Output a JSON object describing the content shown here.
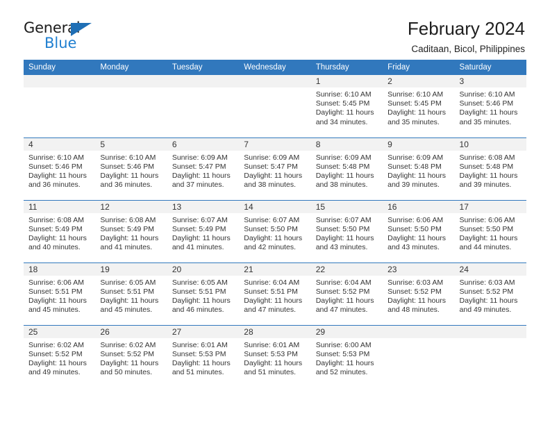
{
  "brand": {
    "name_top": "General",
    "name_bottom": "Blue",
    "triangle_color": "#1f6fb5",
    "blue_color": "#1f7fd0"
  },
  "header": {
    "title": "February 2024",
    "subtitle": "Caditaan, Bicol, Philippines",
    "accent_color": "#3178bd"
  },
  "weekday_headers": [
    "Sunday",
    "Monday",
    "Tuesday",
    "Wednesday",
    "Thursday",
    "Friday",
    "Saturday"
  ],
  "labels": {
    "sunrise_prefix": "Sunrise:",
    "sunset_prefix": "Sunset:",
    "daylight_prefix": "Daylight:"
  },
  "weeks": [
    [
      {
        "day": "",
        "blank": true,
        "sunrise": "",
        "sunset": "",
        "daylight_line1": "",
        "daylight_line2": ""
      },
      {
        "day": "",
        "blank": true,
        "sunrise": "",
        "sunset": "",
        "daylight_line1": "",
        "daylight_line2": ""
      },
      {
        "day": "",
        "blank": true,
        "sunrise": "",
        "sunset": "",
        "daylight_line1": "",
        "daylight_line2": ""
      },
      {
        "day": "",
        "blank": true,
        "sunrise": "",
        "sunset": "",
        "daylight_line1": "",
        "daylight_line2": ""
      },
      {
        "day": "1",
        "blank": false,
        "sunrise": "Sunrise: 6:10 AM",
        "sunset": "Sunset: 5:45 PM",
        "daylight_line1": "Daylight: 11 hours",
        "daylight_line2": "and 34 minutes."
      },
      {
        "day": "2",
        "blank": false,
        "sunrise": "Sunrise: 6:10 AM",
        "sunset": "Sunset: 5:45 PM",
        "daylight_line1": "Daylight: 11 hours",
        "daylight_line2": "and 35 minutes."
      },
      {
        "day": "3",
        "blank": false,
        "sunrise": "Sunrise: 6:10 AM",
        "sunset": "Sunset: 5:46 PM",
        "daylight_line1": "Daylight: 11 hours",
        "daylight_line2": "and 35 minutes."
      }
    ],
    [
      {
        "day": "4",
        "blank": false,
        "sunrise": "Sunrise: 6:10 AM",
        "sunset": "Sunset: 5:46 PM",
        "daylight_line1": "Daylight: 11 hours",
        "daylight_line2": "and 36 minutes."
      },
      {
        "day": "5",
        "blank": false,
        "sunrise": "Sunrise: 6:10 AM",
        "sunset": "Sunset: 5:46 PM",
        "daylight_line1": "Daylight: 11 hours",
        "daylight_line2": "and 36 minutes."
      },
      {
        "day": "6",
        "blank": false,
        "sunrise": "Sunrise: 6:09 AM",
        "sunset": "Sunset: 5:47 PM",
        "daylight_line1": "Daylight: 11 hours",
        "daylight_line2": "and 37 minutes."
      },
      {
        "day": "7",
        "blank": false,
        "sunrise": "Sunrise: 6:09 AM",
        "sunset": "Sunset: 5:47 PM",
        "daylight_line1": "Daylight: 11 hours",
        "daylight_line2": "and 38 minutes."
      },
      {
        "day": "8",
        "blank": false,
        "sunrise": "Sunrise: 6:09 AM",
        "sunset": "Sunset: 5:48 PM",
        "daylight_line1": "Daylight: 11 hours",
        "daylight_line2": "and 38 minutes."
      },
      {
        "day": "9",
        "blank": false,
        "sunrise": "Sunrise: 6:09 AM",
        "sunset": "Sunset: 5:48 PM",
        "daylight_line1": "Daylight: 11 hours",
        "daylight_line2": "and 39 minutes."
      },
      {
        "day": "10",
        "blank": false,
        "sunrise": "Sunrise: 6:08 AM",
        "sunset": "Sunset: 5:48 PM",
        "daylight_line1": "Daylight: 11 hours",
        "daylight_line2": "and 39 minutes."
      }
    ],
    [
      {
        "day": "11",
        "blank": false,
        "sunrise": "Sunrise: 6:08 AM",
        "sunset": "Sunset: 5:49 PM",
        "daylight_line1": "Daylight: 11 hours",
        "daylight_line2": "and 40 minutes."
      },
      {
        "day": "12",
        "blank": false,
        "sunrise": "Sunrise: 6:08 AM",
        "sunset": "Sunset: 5:49 PM",
        "daylight_line1": "Daylight: 11 hours",
        "daylight_line2": "and 41 minutes."
      },
      {
        "day": "13",
        "blank": false,
        "sunrise": "Sunrise: 6:07 AM",
        "sunset": "Sunset: 5:49 PM",
        "daylight_line1": "Daylight: 11 hours",
        "daylight_line2": "and 41 minutes."
      },
      {
        "day": "14",
        "blank": false,
        "sunrise": "Sunrise: 6:07 AM",
        "sunset": "Sunset: 5:50 PM",
        "daylight_line1": "Daylight: 11 hours",
        "daylight_line2": "and 42 minutes."
      },
      {
        "day": "15",
        "blank": false,
        "sunrise": "Sunrise: 6:07 AM",
        "sunset": "Sunset: 5:50 PM",
        "daylight_line1": "Daylight: 11 hours",
        "daylight_line2": "and 43 minutes."
      },
      {
        "day": "16",
        "blank": false,
        "sunrise": "Sunrise: 6:06 AM",
        "sunset": "Sunset: 5:50 PM",
        "daylight_line1": "Daylight: 11 hours",
        "daylight_line2": "and 43 minutes."
      },
      {
        "day": "17",
        "blank": false,
        "sunrise": "Sunrise: 6:06 AM",
        "sunset": "Sunset: 5:50 PM",
        "daylight_line1": "Daylight: 11 hours",
        "daylight_line2": "and 44 minutes."
      }
    ],
    [
      {
        "day": "18",
        "blank": false,
        "sunrise": "Sunrise: 6:06 AM",
        "sunset": "Sunset: 5:51 PM",
        "daylight_line1": "Daylight: 11 hours",
        "daylight_line2": "and 45 minutes."
      },
      {
        "day": "19",
        "blank": false,
        "sunrise": "Sunrise: 6:05 AM",
        "sunset": "Sunset: 5:51 PM",
        "daylight_line1": "Daylight: 11 hours",
        "daylight_line2": "and 45 minutes."
      },
      {
        "day": "20",
        "blank": false,
        "sunrise": "Sunrise: 6:05 AM",
        "sunset": "Sunset: 5:51 PM",
        "daylight_line1": "Daylight: 11 hours",
        "daylight_line2": "and 46 minutes."
      },
      {
        "day": "21",
        "blank": false,
        "sunrise": "Sunrise: 6:04 AM",
        "sunset": "Sunset: 5:51 PM",
        "daylight_line1": "Daylight: 11 hours",
        "daylight_line2": "and 47 minutes."
      },
      {
        "day": "22",
        "blank": false,
        "sunrise": "Sunrise: 6:04 AM",
        "sunset": "Sunset: 5:52 PM",
        "daylight_line1": "Daylight: 11 hours",
        "daylight_line2": "and 47 minutes."
      },
      {
        "day": "23",
        "blank": false,
        "sunrise": "Sunrise: 6:03 AM",
        "sunset": "Sunset: 5:52 PM",
        "daylight_line1": "Daylight: 11 hours",
        "daylight_line2": "and 48 minutes."
      },
      {
        "day": "24",
        "blank": false,
        "sunrise": "Sunrise: 6:03 AM",
        "sunset": "Sunset: 5:52 PM",
        "daylight_line1": "Daylight: 11 hours",
        "daylight_line2": "and 49 minutes."
      }
    ],
    [
      {
        "day": "25",
        "blank": false,
        "sunrise": "Sunrise: 6:02 AM",
        "sunset": "Sunset: 5:52 PM",
        "daylight_line1": "Daylight: 11 hours",
        "daylight_line2": "and 49 minutes."
      },
      {
        "day": "26",
        "blank": false,
        "sunrise": "Sunrise: 6:02 AM",
        "sunset": "Sunset: 5:52 PM",
        "daylight_line1": "Daylight: 11 hours",
        "daylight_line2": "and 50 minutes."
      },
      {
        "day": "27",
        "blank": false,
        "sunrise": "Sunrise: 6:01 AM",
        "sunset": "Sunset: 5:53 PM",
        "daylight_line1": "Daylight: 11 hours",
        "daylight_line2": "and 51 minutes."
      },
      {
        "day": "28",
        "blank": false,
        "sunrise": "Sunrise: 6:01 AM",
        "sunset": "Sunset: 5:53 PM",
        "daylight_line1": "Daylight: 11 hours",
        "daylight_line2": "and 51 minutes."
      },
      {
        "day": "29",
        "blank": false,
        "sunrise": "Sunrise: 6:00 AM",
        "sunset": "Sunset: 5:53 PM",
        "daylight_line1": "Daylight: 11 hours",
        "daylight_line2": "and 52 minutes."
      },
      {
        "day": "",
        "blank": true,
        "sunrise": "",
        "sunset": "",
        "daylight_line1": "",
        "daylight_line2": ""
      },
      {
        "day": "",
        "blank": true,
        "sunrise": "",
        "sunset": "",
        "daylight_line1": "",
        "daylight_line2": ""
      }
    ]
  ]
}
